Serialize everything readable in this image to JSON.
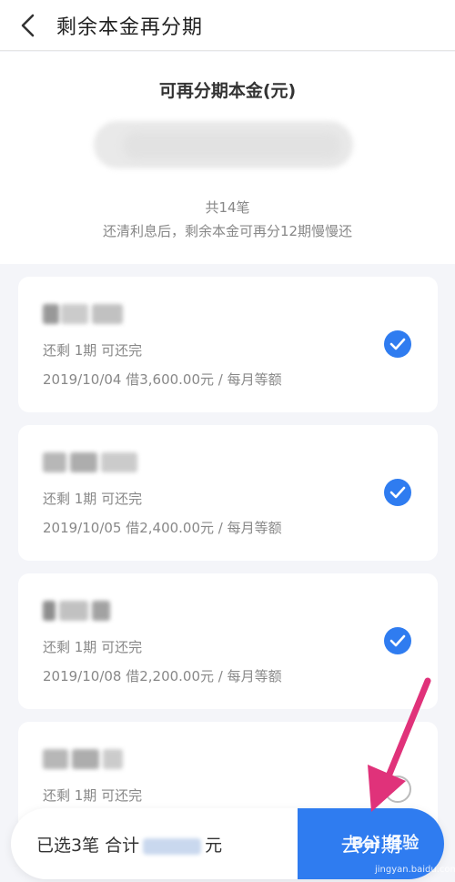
{
  "header": {
    "back_icon": "chevron-left-icon",
    "title": "剩余本金再分期"
  },
  "summary": {
    "title": "可再分期本金(元)",
    "count": "共14笔",
    "note": "还清利息后，剩余本金可再分12期慢慢还"
  },
  "loans": [
    {
      "remaining": "还剩 1期 可还完",
      "detail": "2019/10/04 借3,600.00元 / 每月等额",
      "selected": true
    },
    {
      "remaining": "还剩 1期 可还完",
      "detail": "2019/10/05 借2,400.00元 / 每月等额",
      "selected": true
    },
    {
      "remaining": "还剩 1期 可还完",
      "detail": "2019/10/08 借2,200.00元 / 每月等额",
      "selected": true
    },
    {
      "remaining": "还剩 1期 可还完",
      "detail": "",
      "selected": false
    }
  ],
  "bottom": {
    "selected_prefix": "已选3笔 合计",
    "unit": "元",
    "button": "去分期"
  },
  "watermark": {
    "text": "Bai 经验",
    "sub": "jingyan.baidu.com"
  },
  "colors": {
    "accent": "#2f7cf0",
    "arrow": "#e0327a"
  }
}
